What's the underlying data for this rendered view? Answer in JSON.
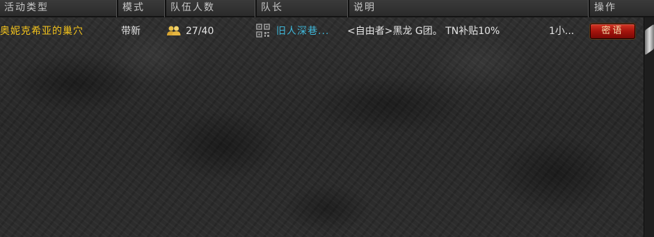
{
  "columns": {
    "activity_type": "活动类型",
    "mode": "模式",
    "team_count": "队伍人数",
    "leader": "队长",
    "description": "说明",
    "action": "操作"
  },
  "rows": [
    {
      "activity": "奥妮克希亚的巢穴",
      "mode": "带新",
      "members": "27/40",
      "leader": "旧人深巷...",
      "description": "<自由者>黑龙 G团。 TN补贴10%",
      "time": "1小...",
      "action_label": "密语"
    }
  ],
  "icons": {
    "members": "people-icon",
    "leader": "qr-code-icon"
  },
  "colors": {
    "activity_text": "#f2c21c",
    "leader_text": "#3fb7d9",
    "button_red": "#a4140c"
  }
}
